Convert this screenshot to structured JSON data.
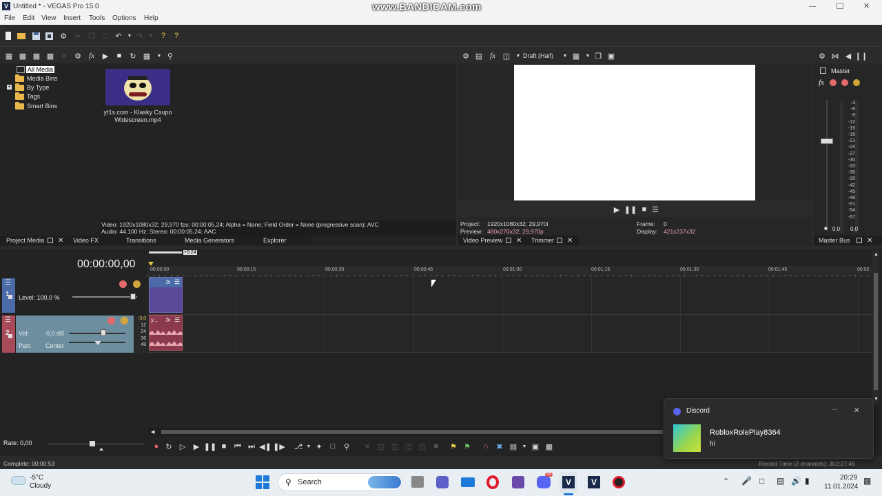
{
  "window": {
    "title": "Untitled * - VEGAS Pro 15.0",
    "watermark": "www.BANDICAM.com"
  },
  "menu": [
    "File",
    "Edit",
    "View",
    "Insert",
    "Tools",
    "Options",
    "Help"
  ],
  "media": {
    "tree": [
      "All Media",
      "Media Bins",
      "By Type",
      "Tags",
      "Smart Bins"
    ],
    "file_name_line1": "yt1s.com - Klasky Csupo",
    "file_name_line2": "Widescreen.mp4",
    "info_video": "Video: 1920x1080x32; 29,970 fps; 00:00:05,24; Alpha = None; Field Order = None (progressive scan); AVC",
    "info_audio": "Audio: 44.100 Hz; Stereo; 00:00:05,24; AAC"
  },
  "bottom_tabs": {
    "project_media": "Project Media",
    "video_fx": "Video FX",
    "transitions": "Transitions",
    "media_generators": "Media Generators",
    "explorer": "Explorer",
    "video_preview": "Video Preview",
    "trimmer": "Trimmer",
    "master_bus": "Master Bus"
  },
  "preview": {
    "quality": "Draft (Half)",
    "project_label": "Project:",
    "project_value": "1920x1080x32; 29,970i",
    "preview_label": "Preview:",
    "preview_value": "480x270x32; 29,970p",
    "frame_label": "Frame:",
    "frame_value": "0",
    "display_label": "Display:",
    "display_value": "421x237x32",
    "accent_color": "#e8a0b4"
  },
  "master": {
    "label": "Master",
    "scale": [
      "3",
      "6",
      "9",
      "12",
      "15",
      "18",
      "21",
      "24",
      "27",
      "30",
      "33",
      "36",
      "39",
      "42",
      "45",
      "48",
      "51",
      "54",
      "57"
    ],
    "left_value": "0,0",
    "right_value": "0,0"
  },
  "timeline": {
    "timecode": "00:00:00,00",
    "loop_length": "+5:24",
    "ruler": [
      "00:00:00",
      "00:00:15",
      "00:00:30",
      "00:00:45",
      "00:01:00",
      "00:01:15",
      "00:01:30",
      "00:01:45",
      "00:02"
    ],
    "track1": {
      "number": "1",
      "level": "Level: 100,0 %",
      "color": "#4a6aa8"
    },
    "track2": {
      "number": "2",
      "vol_label": "Vol:",
      "vol_value": "0,0 dB",
      "pan_label": "Pan:",
      "pan_value": "Center",
      "meter": [
        "-3,0",
        "12",
        "24",
        "36",
        "48"
      ],
      "color": "#a84a5a"
    },
    "audio_clip_label": "y..."
  },
  "transport": {
    "rate": "Rate: 0,00"
  },
  "status": {
    "complete": "Complete: 00:00:53",
    "record_time": "Record Time (2 channels): 302:27:45"
  },
  "notification": {
    "app": "Discord",
    "sender": "RobloxRolePlay8364",
    "message": "hi",
    "menu": "···",
    "close": "✕"
  },
  "taskbar": {
    "temperature": "-5°C",
    "weather": "Cloudy",
    "search_placeholder": "Search",
    "time": "20:29",
    "date": "11.01.2024",
    "discord_badge": "99"
  }
}
